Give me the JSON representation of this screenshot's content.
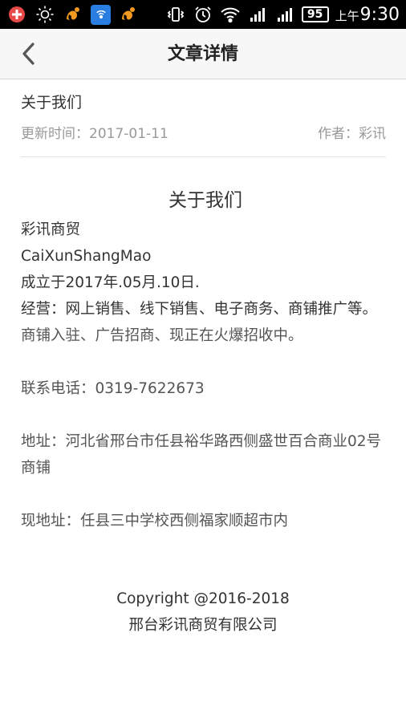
{
  "status_bar": {
    "battery": "95",
    "time_prefix": "上午",
    "time": "9:30",
    "icons": [
      "add-circle-icon",
      "brightness-icon",
      "uc-browser-icon",
      "wifi-share-icon",
      "uc-browser-icon",
      "vibrate-icon",
      "alarm-icon",
      "wifi-icon",
      "signal-icon",
      "signal-icon",
      "battery-icon"
    ]
  },
  "nav": {
    "title": "文章详情",
    "back_icon": "chevron-left-icon"
  },
  "article": {
    "title": "关于我们",
    "update_time": "更新时间：2017-01-11",
    "author": "作者：彩讯"
  },
  "content": {
    "heading": "关于我们",
    "lines": [
      "彩讯商贸",
      "CaiXunShangMao",
      "成立于2017年.05月.10日.",
      "经营：网上销售、线下销售、电子商务、商铺推广等。",
      "商铺入驻、广告招商、现正在火爆招收中。"
    ],
    "phone": "联系电话：0319-7622673",
    "address": "地址：河北省邢台市任县裕华路西侧盛世百合商业02号商铺",
    "current_address": "现地址：任县三中学校西侧福家顺超市内"
  },
  "footer": {
    "copyright": "Copyright @2016-2018",
    "company": "邢台彩讯商贸有限公司"
  },
  "colors": {
    "status_bar_bg": "#000000",
    "nav_bg": "#f7f7f7",
    "meta_text": "#999999",
    "body_text": "#333333"
  }
}
